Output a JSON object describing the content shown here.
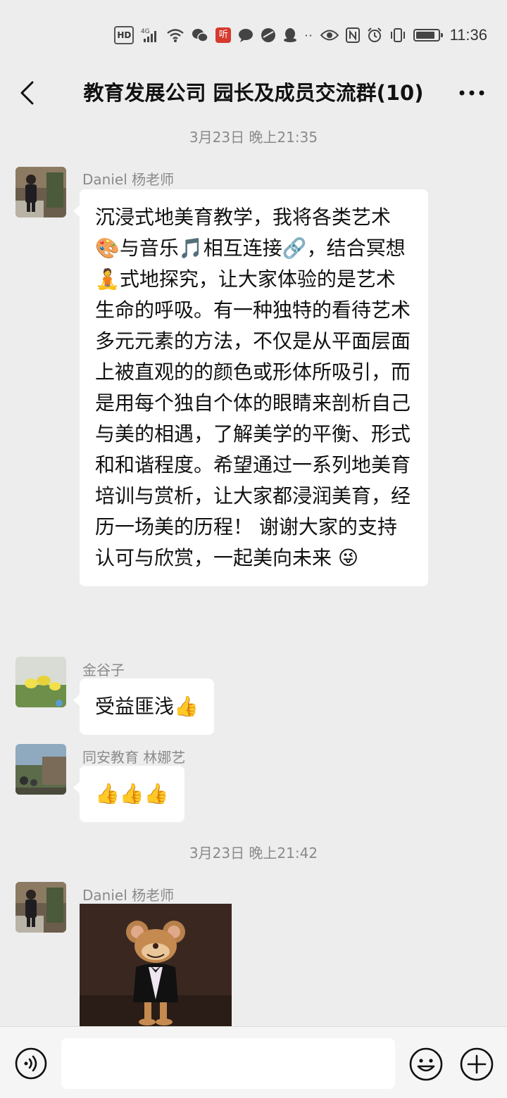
{
  "status_bar": {
    "hd": "HD",
    "network": "4G",
    "app_badge": "听",
    "dots": "··",
    "time": "11:36"
  },
  "header": {
    "title": "教育发展公司 园长及成员交流群(10)"
  },
  "messages": [
    {
      "timestamp": "3月23日 晚上21:35",
      "sender": "Daniel 杨老师",
      "text": "沉浸式地美育教学，我将各类艺术🎨与音乐🎵相互连接🔗，结合冥想🧘式地探究，让大家体验的是艺术生命的呼吸。有一种独特的看待艺术多元元素的方法，不仅是从平面层面上被直观的的颜色或形体所吸引，而是用每个独自个体的眼睛来剖析自己与美的相遇，了解美学的平衡、形式和和谐程度。希望通过一系列地美育培训与赏析，让大家都浸润美育，经历一场美的历程！ 谢谢大家的支持认可与欣赏，一起美向未来 😜"
    },
    {
      "sender": "金谷子",
      "text": "受益匪浅👍"
    },
    {
      "sender": "同安教育 林娜艺",
      "text": "👍👍👍"
    },
    {
      "timestamp": "3月23日 晚上21:42",
      "sender": "Daniel 杨老师",
      "sticker": "cartoon-mouse-sticker"
    }
  ],
  "input_bar": {
    "placeholder": ""
  },
  "colors": {
    "background": "#ededed",
    "bubble": "#ffffff",
    "meta_text": "#8a8a8a"
  }
}
